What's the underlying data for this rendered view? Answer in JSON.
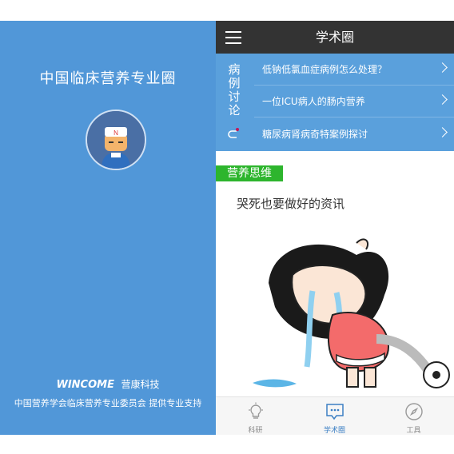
{
  "splash": {
    "title": "中国临床营养专业圈",
    "brand_en": "WINCOME",
    "brand_cn": "营康科技",
    "support_text": "中国营养学会临床营养专业委员会 提供专业支持"
  },
  "app": {
    "title": "学术圈",
    "discussion": {
      "label": "病例讨论",
      "items": [
        {
          "text": "低钠低氯血症病例怎么处理？"
        },
        {
          "text": "一位ICU病人的肠内营养"
        },
        {
          "text": "糖尿病肾病奇特案例探讨"
        }
      ]
    },
    "section_tag": "营养思维",
    "article_title": "哭死也要做好的资讯",
    "tabs": [
      {
        "label": "科研",
        "icon": "lightbulb-icon"
      },
      {
        "label": "学术圈",
        "icon": "chat-icon"
      },
      {
        "label": "工具",
        "icon": "compass-icon"
      }
    ]
  },
  "colors": {
    "splash_bg": "#5197d8",
    "topbar_bg": "#333333",
    "discussion_bg": "#5aa0dc",
    "section_tag_bg": "#2db52d",
    "tab_active": "#3b7fc4"
  }
}
